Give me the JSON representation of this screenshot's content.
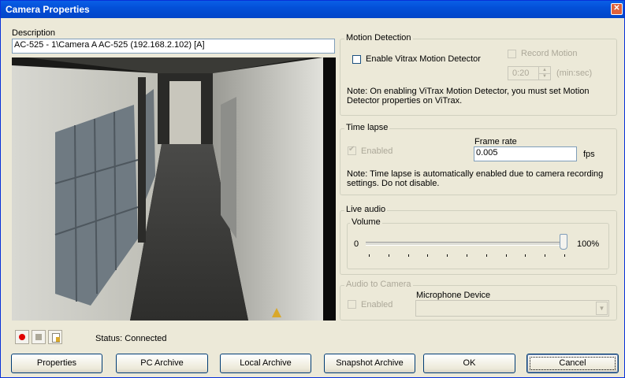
{
  "window": {
    "title": "Camera Properties",
    "close_glyph": "✕"
  },
  "description": {
    "label": "Description",
    "value": "AC-525 - 1\\Camera A AC-525 (192.168.2.102) [A]"
  },
  "motion_detection": {
    "title": "Motion Detection",
    "enable_label": "Enable Vitrax Motion Detector",
    "enable_checked": false,
    "record_label": "Record Motion",
    "record_checked": false,
    "duration_value": "0:20",
    "duration_unit": "(min:sec)",
    "note": "Note: On enabling ViTrax Motion Detector, you must set Motion Detector properties on ViTrax."
  },
  "time_lapse": {
    "title": "Time lapse",
    "enabled_label": "Enabled",
    "enabled_checked": true,
    "frame_rate_label": "Frame rate",
    "frame_rate_value": "0.005",
    "frame_rate_unit": "fps",
    "note": "Note: Time lapse is automatically enabled due to camera recording settings. Do not disable."
  },
  "live_audio": {
    "title": "Live audio",
    "volume_label": "Volume",
    "min_label": "0",
    "max_label": "100%",
    "volume_fraction": 1.0
  },
  "audio_to_camera": {
    "title": "Audio to Camera",
    "enabled_label": "Enabled",
    "enabled_checked": false,
    "microphone_label": "Microphone Device",
    "microphone_value": ""
  },
  "status": {
    "text": "Status: Connected"
  },
  "controls": {
    "record_icon": "record-icon",
    "stop_icon": "stop-icon",
    "clip_icon": "document-icon"
  },
  "buttons": {
    "properties": "Properties",
    "pc_archive": "PC Archive",
    "local_archive": "Local Archive",
    "snapshot_archive": "Snapshot Archive",
    "ok": "OK",
    "cancel": "Cancel"
  },
  "colors": {
    "title_blue": "#0350d8",
    "record_red": "#e00000"
  }
}
